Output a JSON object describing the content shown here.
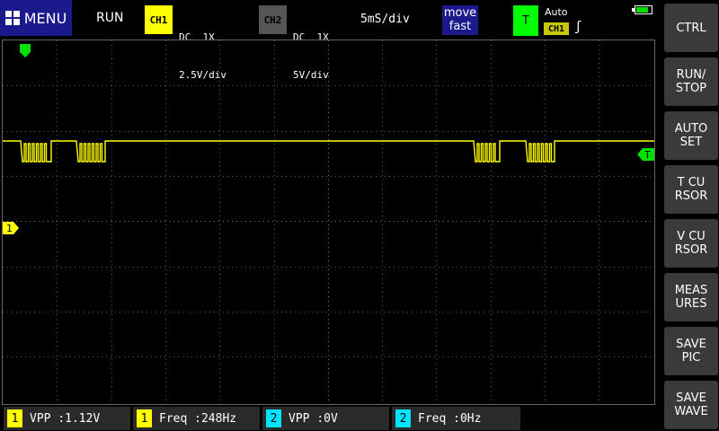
{
  "header": {
    "menu_label": "MENU",
    "run_status": "RUN",
    "ch1": {
      "badge": "CH1",
      "coupling": "DC  1X",
      "scale": "2.5V/div"
    },
    "ch2": {
      "badge": "CH2",
      "coupling": "DC  1X",
      "scale": "5V/div"
    },
    "timebase": "5mS/div",
    "move_line1": "move",
    "move_line2": "fast",
    "trigger": {
      "badge": "T",
      "mode": "Auto",
      "source": "CH1",
      "edge_symbol": "ʃ"
    },
    "battery_level": 0.8
  },
  "scope": {
    "ch1_marker": "1",
    "trigger_marker": "T",
    "colors": {
      "ch1": "#ffff00",
      "trigger": "#00e000",
      "grid": "#777777"
    }
  },
  "side_menu": [
    {
      "id": "ctrl",
      "label": "CTRL"
    },
    {
      "id": "run-stop",
      "label": "RUN/\nSTOP"
    },
    {
      "id": "auto-set",
      "label": "AUTO\nSET"
    },
    {
      "id": "t-cursor",
      "label": "T CU\nRSOR"
    },
    {
      "id": "v-cursor",
      "label": "V CU\nRSOR"
    },
    {
      "id": "measures",
      "label": "MEAS\nURES"
    },
    {
      "id": "save-pic",
      "label": "SAVE\nPIC"
    },
    {
      "id": "save-wave",
      "label": "SAVE\nWAVE"
    }
  ],
  "measurements": [
    {
      "ch": "1",
      "label": "VPP",
      "value": ":1.12V"
    },
    {
      "ch": "1",
      "label": "Freq",
      "value": ":248Hz"
    },
    {
      "ch": "2",
      "label": "VPP",
      "value": ":0V"
    },
    {
      "ch": "2",
      "label": "Freq",
      "value": ":0Hz"
    }
  ]
}
